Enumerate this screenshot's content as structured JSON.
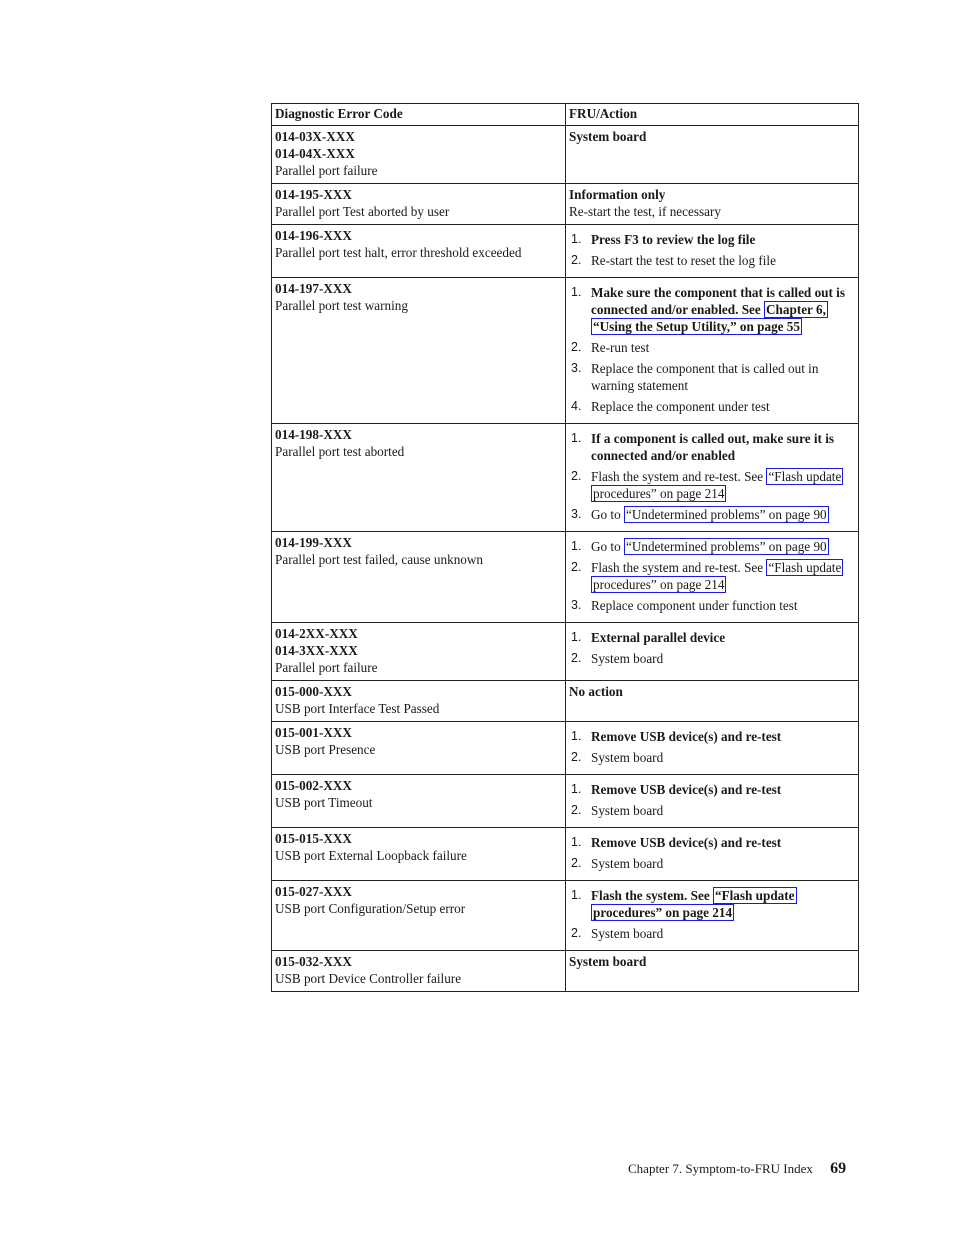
{
  "table": {
    "headers": [
      "Diagnostic Error Code",
      "FRU/Action"
    ],
    "rows": [
      {
        "codes": [
          "014-03X-XXX",
          "014-04X-XXX"
        ],
        "description": "Parallel port failure",
        "fru_text": "System board",
        "fru_bold": true
      },
      {
        "codes": [
          "014-195-XXX"
        ],
        "description": "Parallel port Test aborted by user",
        "fru_text": "Information only",
        "fru_bold": true,
        "fru_note": "Re-start the test, if necessary"
      },
      {
        "codes": [
          "014-196-XXX"
        ],
        "description": "Parallel port test halt, error threshold exceeded",
        "actions": [
          {
            "n": "1.",
            "text": "Press F3 to review the log file",
            "bold": true
          },
          {
            "n": "2.",
            "text": "Re-start the test to reset the log file",
            "bold": false
          }
        ]
      },
      {
        "codes": [
          "014-197-XXX"
        ],
        "description": "Parallel port test warning",
        "actions": [
          {
            "n": "1.",
            "text": "Make sure the component that is called out is connected and/or enabled. See ",
            "bold": true,
            "link": "Chapter 6, “Using the Setup Utility,” on page 55"
          },
          {
            "n": "2.",
            "text": "Re-run test",
            "bold": false
          },
          {
            "n": "3.",
            "text": "Replace the component that is called out in warning statement",
            "bold": false
          },
          {
            "n": "4.",
            "text": "Replace the component under test",
            "bold": false
          }
        ]
      },
      {
        "codes": [
          "014-198-XXX"
        ],
        "description": "Parallel port test aborted",
        "actions": [
          {
            "n": "1.",
            "text": "If a component is called out, make sure it is connected and/or enabled",
            "bold": true
          },
          {
            "n": "2.",
            "text": "Flash the system and re-test. See ",
            "bold": false,
            "link": "“Flash update procedures” on page 214"
          },
          {
            "n": "3.",
            "text": "Go to ",
            "bold": false,
            "link": "“Undetermined problems” on page 90"
          }
        ]
      },
      {
        "codes": [
          "014-199-XXX"
        ],
        "description": "Parallel port test failed, cause unknown",
        "actions": [
          {
            "n": "1.",
            "text": "Go to ",
            "bold": false,
            "link": "“Undetermined problems” on page 90"
          },
          {
            "n": "2.",
            "text": "Flash the system and re-test. See ",
            "bold": false,
            "link": "“Flash update procedures” on page 214"
          },
          {
            "n": "3.",
            "text": "Replace component under function test",
            "bold": false
          }
        ]
      },
      {
        "codes": [
          "014-2XX-XXX",
          "014-3XX-XXX"
        ],
        "description": "Parallel port failure",
        "actions": [
          {
            "n": "1.",
            "text": "External parallel device",
            "bold": true
          },
          {
            "n": "2.",
            "text": "System board",
            "bold": false
          }
        ]
      },
      {
        "codes": [
          "015-000-XXX"
        ],
        "description": "USB port Interface Test Passed",
        "fru_text": "No action",
        "fru_bold": true
      },
      {
        "codes": [
          "015-001-XXX"
        ],
        "description": "USB port Presence",
        "actions": [
          {
            "n": "1.",
            "text": "Remove USB device(s) and re-test",
            "bold": true
          },
          {
            "n": "2.",
            "text": "System board",
            "bold": false
          }
        ]
      },
      {
        "codes": [
          "015-002-XXX"
        ],
        "description": "USB port Timeout",
        "actions": [
          {
            "n": "1.",
            "text": "Remove USB device(s) and re-test",
            "bold": true
          },
          {
            "n": "2.",
            "text": "System board",
            "bold": false
          }
        ]
      },
      {
        "codes": [
          "015-015-XXX"
        ],
        "description": "USB port External Loopback failure",
        "actions": [
          {
            "n": "1.",
            "text": "Remove USB device(s) and re-test",
            "bold": true
          },
          {
            "n": "2.",
            "text": "System board",
            "bold": false
          }
        ]
      },
      {
        "codes": [
          "015-027-XXX"
        ],
        "description": "USB port Configuration/Setup error",
        "actions": [
          {
            "n": "1.",
            "text": "Flash the system. See ",
            "bold": true,
            "link": "“Flash update procedures” on page 214"
          },
          {
            "n": "2.",
            "text": "System board",
            "bold": false
          }
        ]
      },
      {
        "codes": [
          "015-032-XXX"
        ],
        "description": "USB port Device Controller failure",
        "fru_text": "System board",
        "fru_bold": true
      }
    ]
  },
  "footer": {
    "chapter": "Chapter 7. Symptom-to-FRU Index",
    "page_number": "69"
  },
  "colors": {
    "link_border": "#1a1ae6",
    "rule": "#222222"
  }
}
